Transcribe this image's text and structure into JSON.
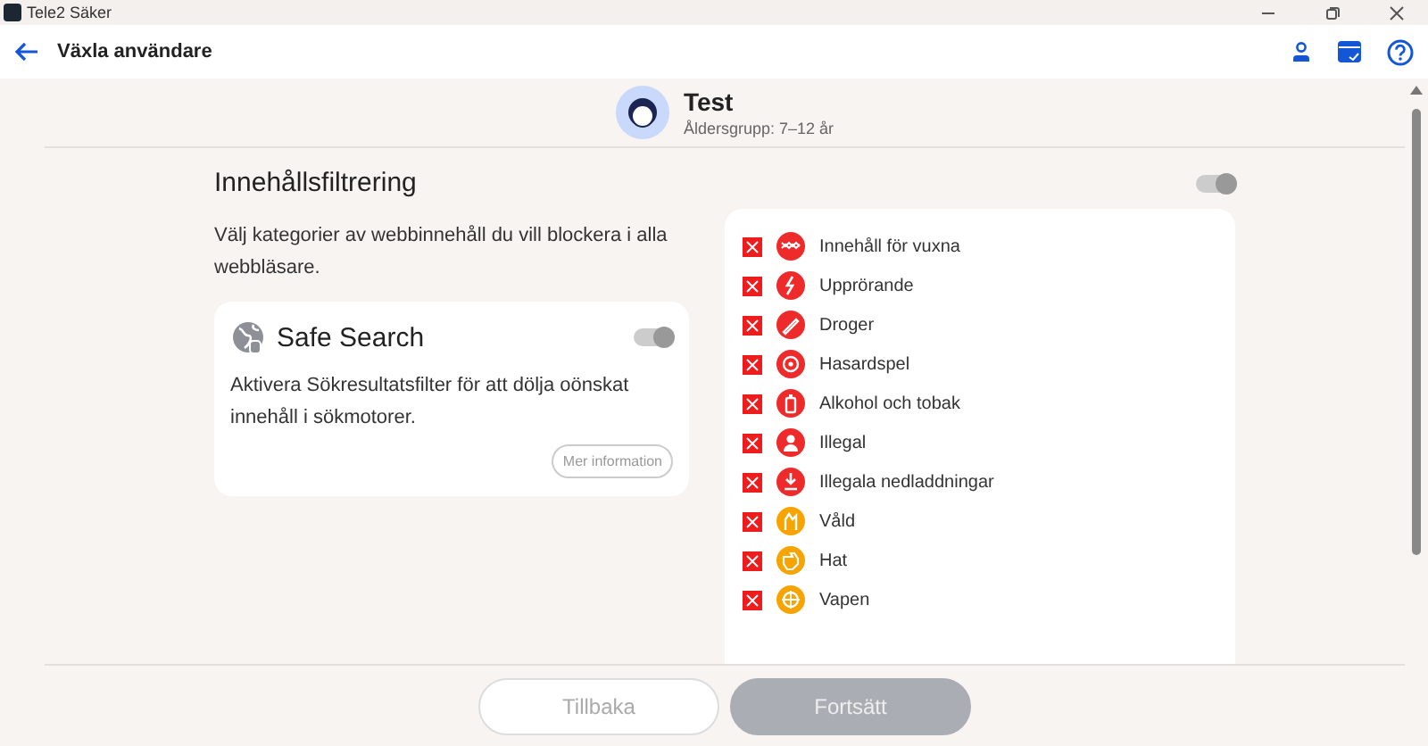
{
  "window": {
    "title": "Tele2 Säker"
  },
  "header": {
    "title": "Växla användare"
  },
  "profile": {
    "name": "Test",
    "age_group": "Åldersgrupp: 7–12 år"
  },
  "filtering": {
    "title": "Innehållsfiltrering",
    "on": true,
    "disabled": true,
    "description": "Välj kategorier av webbinnehåll du vill blockera i alla webbläsare."
  },
  "safe_search": {
    "title": "Safe Search",
    "on": true,
    "disabled": true,
    "description": "Aktivera Sökresultatsfilter för att dölja oönskat innehåll i sökmotorer.",
    "link": "Mer information"
  },
  "categories": [
    {
      "label": "Innehåll för vuxna",
      "checked": true,
      "color": "#ee2a2a"
    },
    {
      "label": "Upprörande",
      "checked": true,
      "color": "#ee2a2a"
    },
    {
      "label": "Droger",
      "checked": true,
      "color": "#ee2a2a"
    },
    {
      "label": "Hasardspel",
      "checked": true,
      "color": "#ee2a2a"
    },
    {
      "label": "Alkohol och tobak",
      "checked": true,
      "color": "#ee2a2a"
    },
    {
      "label": "Illegal",
      "checked": true,
      "color": "#ee2a2a"
    },
    {
      "label": "Illegala nedladdningar",
      "checked": true,
      "color": "#ee2a2a"
    },
    {
      "label": "Våld",
      "checked": true,
      "color": "#f7a400"
    },
    {
      "label": "Hat",
      "checked": true,
      "color": "#f7a400"
    },
    {
      "label": "Vapen",
      "checked": true,
      "color": "#f7a400"
    }
  ],
  "buttons": [
    {
      "label": "Tillbaka",
      "kind": "outline"
    },
    {
      "label": "Fortsätt",
      "kind": "filled"
    }
  ]
}
